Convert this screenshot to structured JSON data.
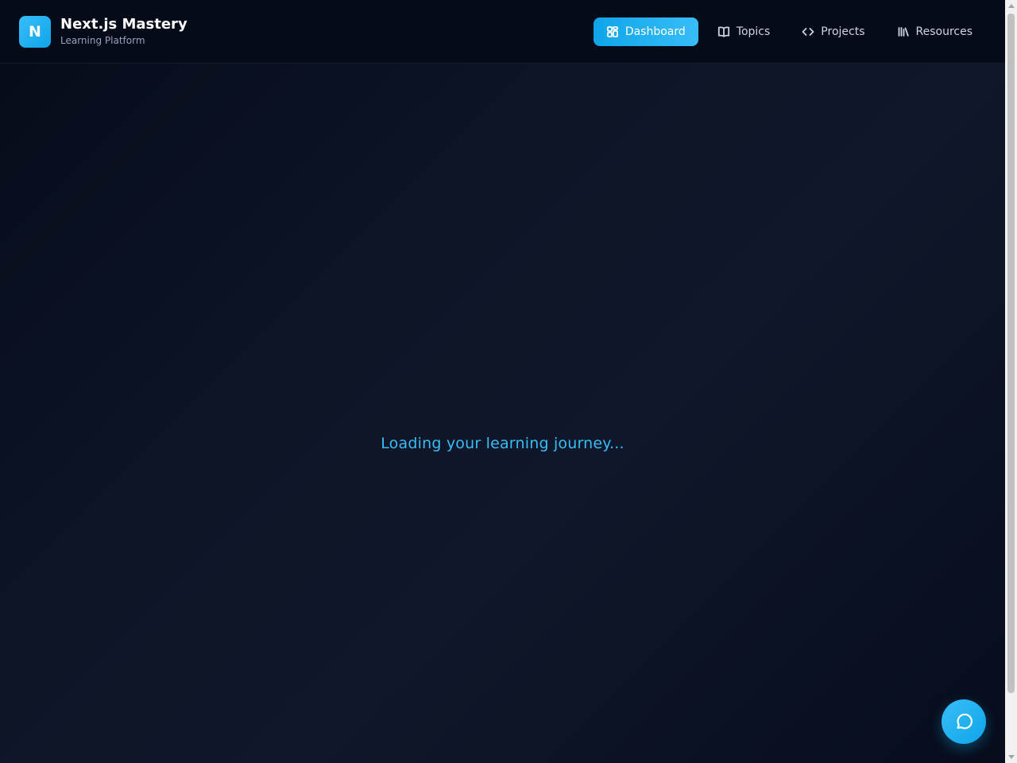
{
  "brand": {
    "logo_letter": "N",
    "title": "Next.js Mastery",
    "subtitle": "Learning Platform"
  },
  "nav": {
    "items": [
      {
        "label": "Dashboard",
        "icon": "dashboard-grid-icon",
        "active": true
      },
      {
        "label": "Topics",
        "icon": "book-icon",
        "active": false
      },
      {
        "label": "Projects",
        "icon": "code-icon",
        "active": false
      },
      {
        "label": "Resources",
        "icon": "library-icon",
        "active": false
      }
    ]
  },
  "main": {
    "loading_text": "Loading your learning journey..."
  },
  "chat": {
    "icon": "chat-bubble-icon"
  },
  "colors": {
    "accent": "#0ea5e9",
    "accent_light": "#38bdf8",
    "background": "#0b1120",
    "header_bg": "#060b1a"
  }
}
